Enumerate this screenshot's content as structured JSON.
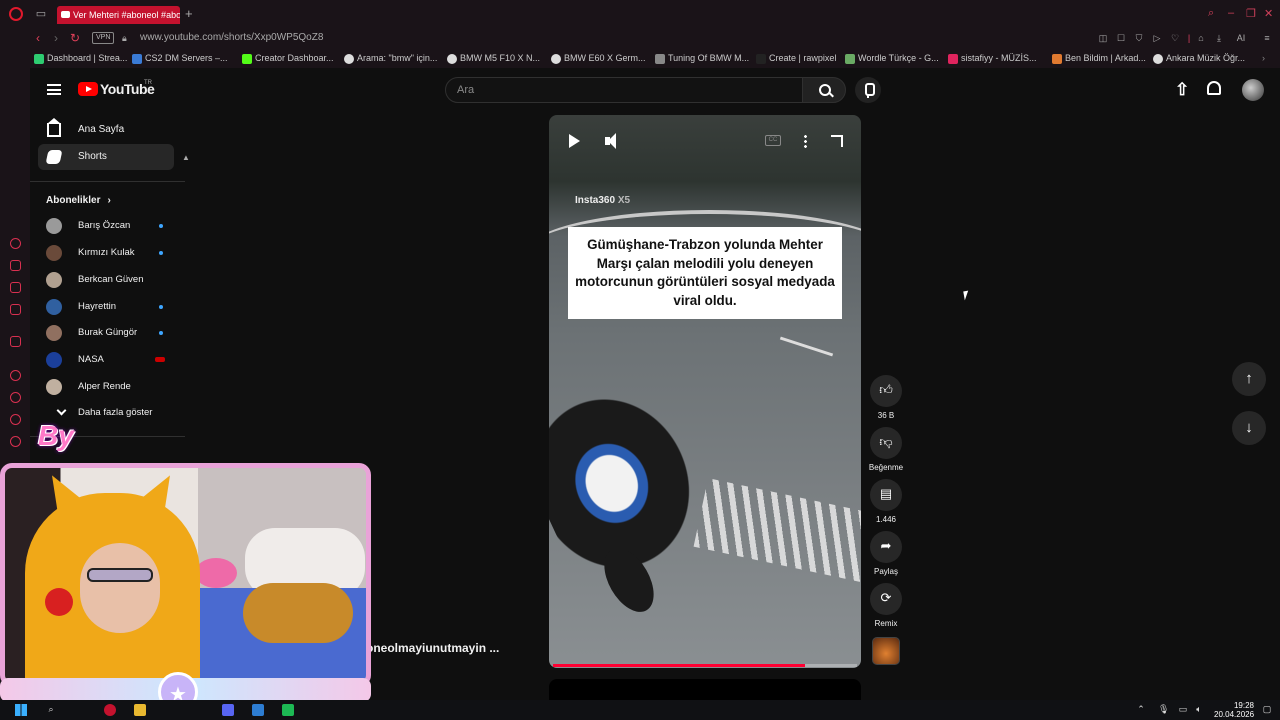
{
  "browser": {
    "tab_title": "Ver Mehteri #aboneol #abo",
    "url": "www.youtube.com/shorts/Xxp0WP5QoZ8",
    "vpn_label": "VPN",
    "bookmarks": [
      {
        "label": "Dashboard | Strea...",
        "color": "#2ecc71"
      },
      {
        "label": "CS2 DM Servers –...",
        "color": "#3a7bd5"
      },
      {
        "label": "Creator Dashboar...",
        "color": "#53fc18"
      },
      {
        "label": "Arama: \"bmw\" için...",
        "color": "#dddddd"
      },
      {
        "label": "BMW M5 F10 X N...",
        "color": "#dddddd"
      },
      {
        "label": "BMW E60 X Germ...",
        "color": "#dddddd"
      },
      {
        "label": "Tuning Of BMW M...",
        "color": "#888888"
      },
      {
        "label": "Create | rawpixel",
        "color": "#222222"
      },
      {
        "label": "Wordle Türkçe - G...",
        "color": "#6aaa64"
      },
      {
        "label": "sistafiyy - MÜZİS...",
        "color": "#e0245e"
      },
      {
        "label": "Ben Bildim | Arkad...",
        "color": "#e07a30"
      },
      {
        "label": "Ankara Müzik Öğr...",
        "color": "#dddddd"
      }
    ]
  },
  "youtube": {
    "logo_text": "YouTube",
    "logo_region": "TR",
    "search_placeholder": "Ara",
    "guide": {
      "home_label": "Ana Sayfa",
      "shorts_label": "Shorts",
      "subscriptions_header": "Abonelikler",
      "subscriptions": [
        {
          "name": "Barış Özcan",
          "indicator": "new",
          "avatar": "#9a9a9a"
        },
        {
          "name": "Kırmızı Kulak",
          "indicator": "new",
          "avatar": "#6a4a3a"
        },
        {
          "name": "Berkcan Güven",
          "indicator": "none",
          "avatar": "#b0a090"
        },
        {
          "name": "Hayrettin",
          "indicator": "new",
          "avatar": "#3060a0"
        },
        {
          "name": "Burak Güngör",
          "indicator": "new",
          "avatar": "#907060"
        },
        {
          "name": "NASA",
          "indicator": "live",
          "avatar": "#1b3f9a"
        },
        {
          "name": "Alper Rende",
          "indicator": "none",
          "avatar": "#c0b0a0"
        }
      ],
      "show_more_label": "Daha fazla göster"
    },
    "short": {
      "watermark_brand": "Insta360",
      "watermark_model": "X5",
      "caption": "Gümüşhane-Trabzon yolunda Mehter Marşı çalan melodili yolu deneyen motorcunun görüntüleri sosyal medyada viral oldu.",
      "cc_label": "CC",
      "progress": 0.83,
      "channel_name": "oneolmayiunutmayin ..."
    },
    "actions": {
      "like_count": "36 B",
      "dislike_label": "Beğenme",
      "comment_count": "1.446",
      "share_label": "Paylaş",
      "remix_label": "Remix"
    }
  },
  "overlay": {
    "by_text": "By"
  },
  "taskbar": {
    "time": "19:28",
    "date": "20.04.2026"
  },
  "colors": {
    "opera_red": "#e0192c",
    "yt_red": "#ff0000",
    "progress_red": "#ff0033",
    "webcam_frame": "#e9a3d8"
  }
}
